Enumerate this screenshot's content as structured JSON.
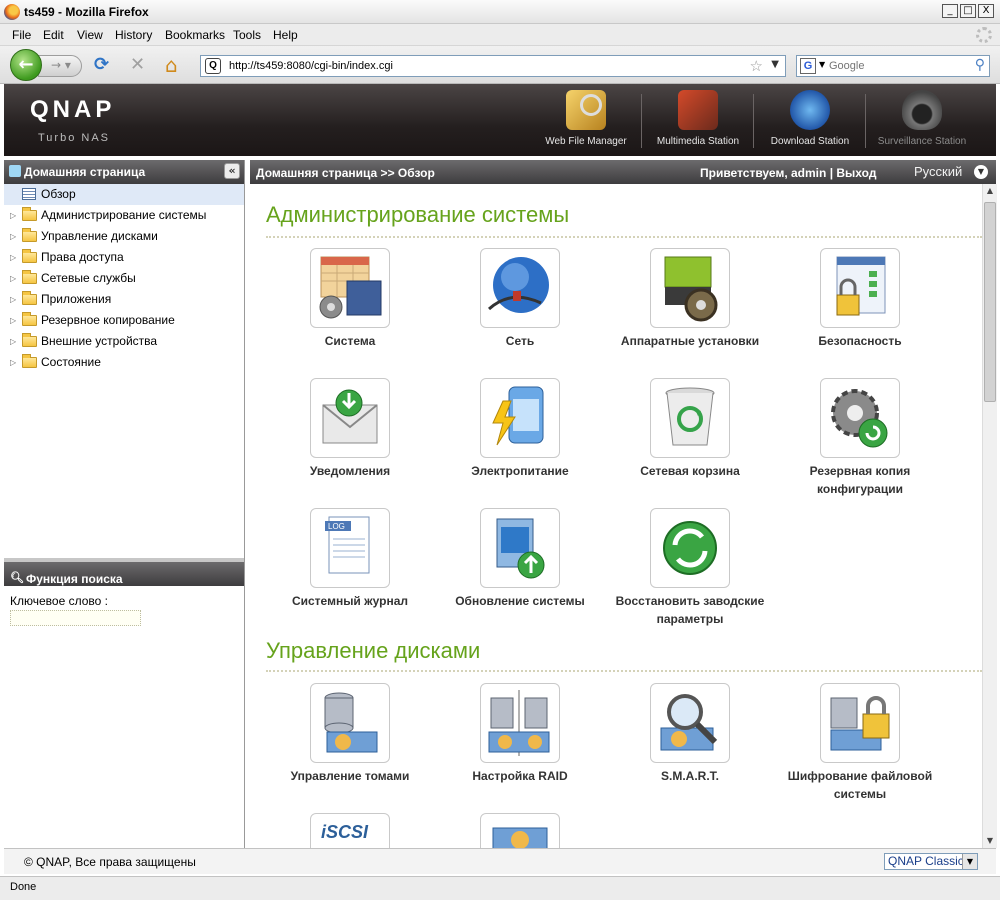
{
  "window": {
    "title": "ts459 - Mozilla Firefox",
    "minimize": "_",
    "maximize": "□",
    "close": "X"
  },
  "menu": [
    "File",
    "Edit",
    "View",
    "History",
    "Bookmarks",
    "Tools",
    "Help"
  ],
  "nav": {
    "back": "←",
    "forward": "→",
    "reload": "⟳",
    "stop": "✕",
    "home": "⌂",
    "site_icon": "Q",
    "url": "http://ts459:8080/cgi-bin/index.cgi",
    "bookmark_star": "☆",
    "search_engine": "G",
    "search_placeholder": "Google"
  },
  "qnap": {
    "logo": "QNAP",
    "subtitle": "Turbo NAS",
    "apps": [
      "Web File Manager",
      "Multimedia Station",
      "Download Station",
      "Surveillance Station"
    ]
  },
  "sidebar": {
    "title": "Домашняя страница",
    "collapse": "«",
    "items": [
      "Обзор",
      "Администрирование системы",
      "Управление дисками",
      "Права доступа",
      "Сетевые службы",
      "Приложения",
      "Резервное копирование",
      "Внешние устройства",
      "Состояние"
    ],
    "search_title": "Функция поиска",
    "search_icon": "magnifier-icon",
    "keyword_label": "Ключевое слово :"
  },
  "main": {
    "breadcrumb": "Домашняя страница >> Обзор",
    "greeting": "Приветствуем,",
    "user": "admin",
    "separator": "|",
    "logout": "Выход",
    "language": "Русский",
    "sections": [
      {
        "title": "Администрирование системы",
        "tiles": [
          {
            "label": "Система",
            "icon": "system-icon"
          },
          {
            "label": "Сеть",
            "icon": "network-icon"
          },
          {
            "label": "Аппаратные установки",
            "icon": "hardware-icon"
          },
          {
            "label": "Безопасность",
            "icon": "security-icon"
          },
          {
            "label": "Уведомления",
            "icon": "notification-icon"
          },
          {
            "label": "Электропитание",
            "icon": "power-icon"
          },
          {
            "label": "Сетевая корзина",
            "icon": "recycle-bin-icon"
          },
          {
            "label": "Резервная копия конфигурации",
            "icon": "config-backup-icon"
          },
          {
            "label": "Системный журнал",
            "icon": "log-icon"
          },
          {
            "label": "Обновление системы",
            "icon": "firmware-update-icon"
          },
          {
            "label": "Восстановить заводские параметры",
            "icon": "restore-icon"
          }
        ]
      },
      {
        "title": "Управление дисками",
        "tiles": [
          {
            "label": "Управление томами",
            "icon": "volume-icon"
          },
          {
            "label": "Настройка RAID",
            "icon": "raid-icon"
          },
          {
            "label": "S.M.A.R.T.",
            "icon": "smart-icon"
          },
          {
            "label": "Шифрование файловой системы",
            "icon": "encryption-icon"
          },
          {
            "label": "",
            "icon": "iscsi-icon",
            "badge": "iSCSI"
          },
          {
            "label": "",
            "icon": "virtual-disk-icon"
          }
        ]
      }
    ]
  },
  "footer": {
    "copyright": "© QNAP, Все права защищены",
    "theme": "QNAP Classic"
  },
  "status": "Done",
  "colors": {
    "accent_green": "#66a31c",
    "header_dark": "#241f1f"
  }
}
